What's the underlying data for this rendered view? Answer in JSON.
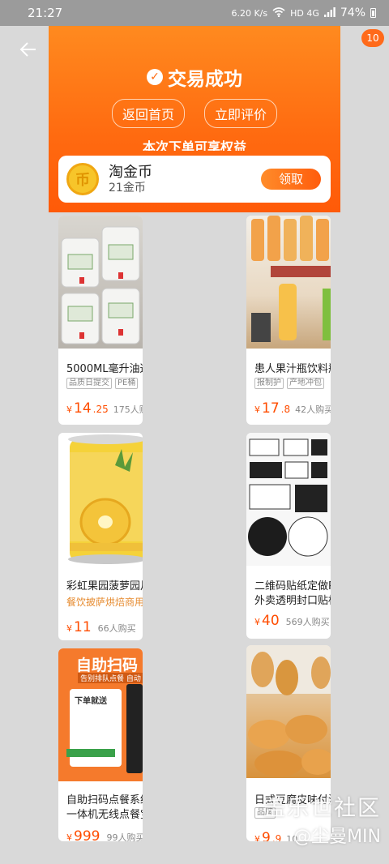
{
  "status_bar": {
    "time": "21:27",
    "net_speed": "6.20 K/s",
    "network": "HD 4G",
    "battery": "74%"
  },
  "badge": {
    "count": "10"
  },
  "hero": {
    "title": "交易成功",
    "buttons": [
      "返回首页",
      "立即评价"
    ],
    "subtitle": "本次下单可享权益"
  },
  "coin": {
    "title": "淘金币",
    "subtitle": "21金币",
    "button": "领取",
    "icon_char": "币"
  },
  "products": [
    {
      "name": "5000ML毫升油这",
      "tags": [
        "品质日提交",
        "PE桶"
      ],
      "price_int": "14",
      "price_dec": ".25",
      "sold": "175人购买"
    },
    {
      "name": "患人果汁瓶饮料瓶",
      "tags": [
        "报制护",
        "产地冲包"
      ],
      "price_int": "17",
      "price_dec": ".8",
      "sold": "42人购买"
    },
    {
      "name": "彩虹果园菠萝园片",
      "tagline": "餐饮披萨烘焙商用",
      "price_int": "11",
      "price_dec": "",
      "sold": "66人购买"
    },
    {
      "name": "二维码贴纸定做PV",
      "name2": "外卖透明封口贴标",
      "price_int": "40",
      "price_dec": "",
      "sold": "569人购买"
    },
    {
      "name": "自助扫码点餐系统",
      "name2": "一体机无线点餐宝",
      "price_int": "999",
      "price_dec": "",
      "sold": "99人购买"
    },
    {
      "name": "日式豆腐皮味付油",
      "tags": [
        "品牌"
      ],
      "price_int": "9",
      "price_dec": ".9",
      "sold": "10"
    }
  ],
  "kiosk_banner": {
    "title": "自助扫码",
    "sub": "告别排队点餐 自动",
    "label": "下单就送"
  },
  "watermark": {
    "line1": "盖乐世社区",
    "line2": "@尘曼MIN"
  }
}
